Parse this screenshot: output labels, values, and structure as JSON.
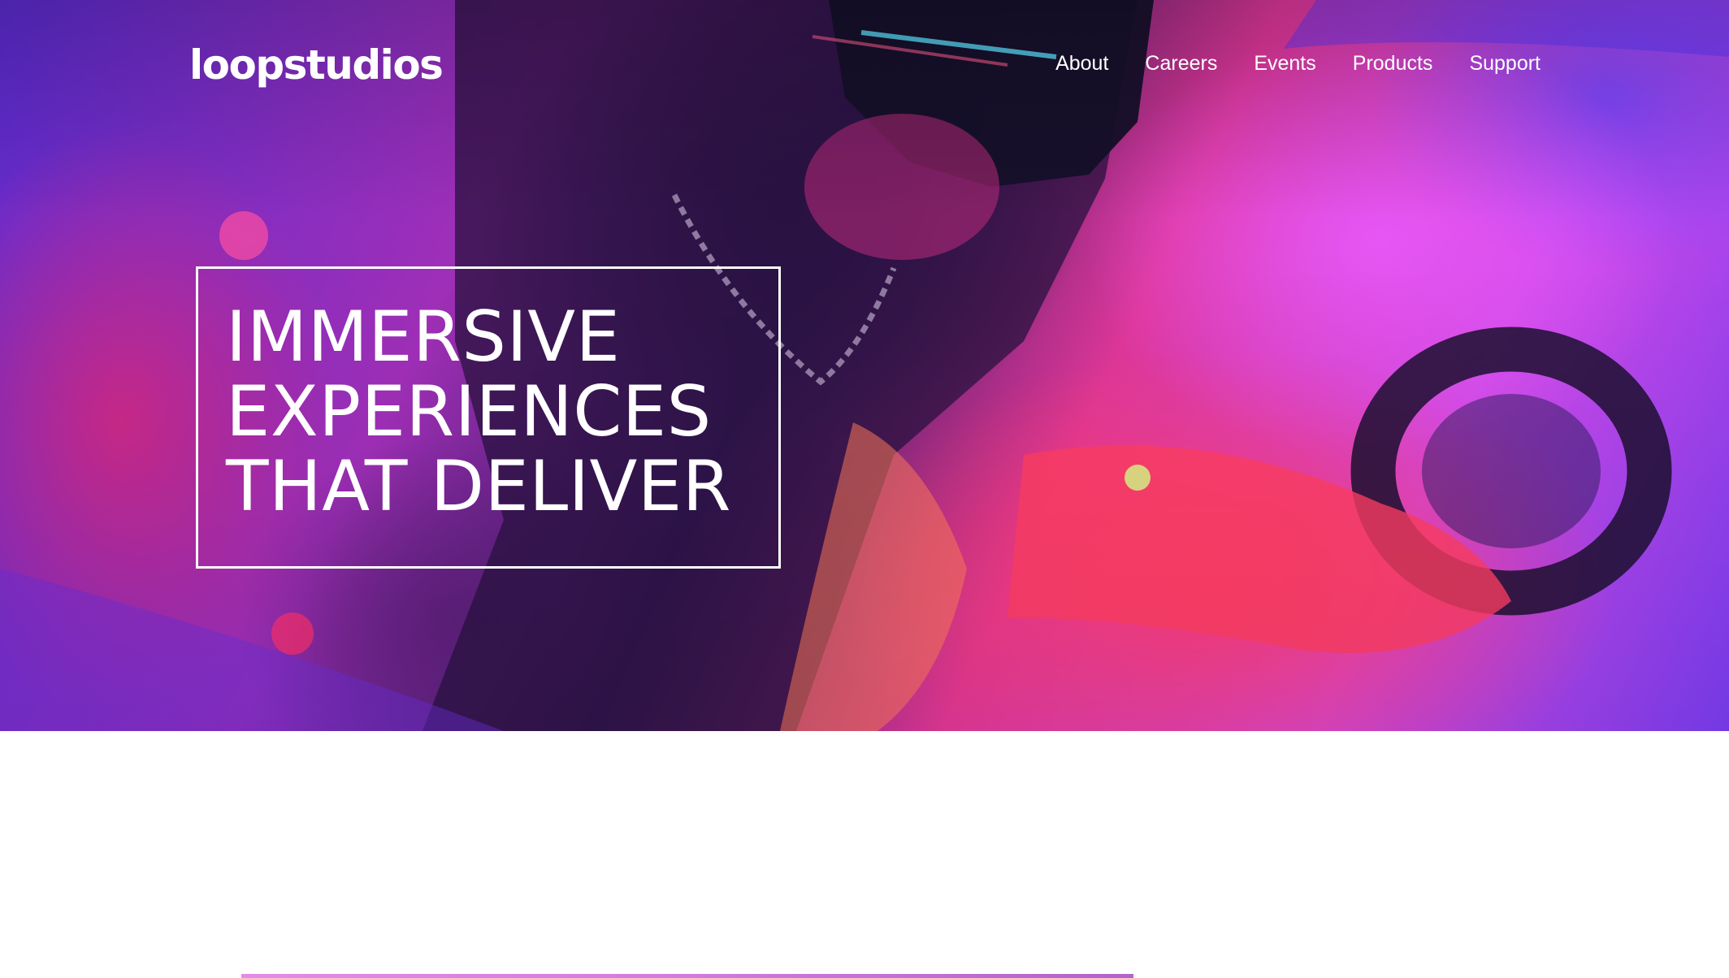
{
  "header": {
    "logo": "loopstudios",
    "nav": [
      {
        "label": "About"
      },
      {
        "label": "Careers"
      },
      {
        "label": "Events"
      },
      {
        "label": "Products"
      },
      {
        "label": "Support"
      }
    ]
  },
  "hero": {
    "headline": "IMMERSIVE\nEXPERIENCES\nTHAT DELIVER"
  },
  "colors": {
    "text_on_hero": "#ffffff",
    "page_background": "#ffffff",
    "accent_line": "#d07bdd"
  }
}
